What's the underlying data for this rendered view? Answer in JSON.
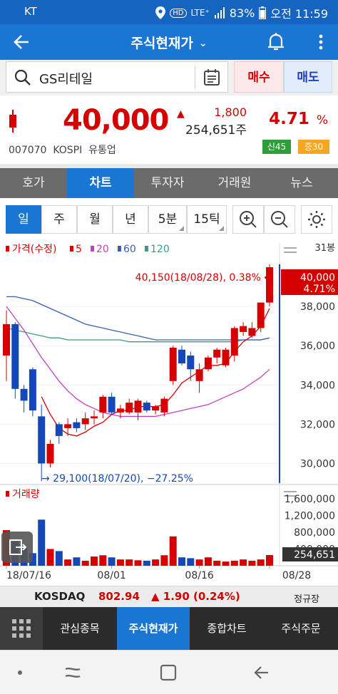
{
  "status_bar": {
    "carrier": "KT",
    "network": "LTE⁺",
    "battery": "83%",
    "time": "오전 11:59"
  },
  "app_bar": {
    "title": "주식현재가"
  },
  "search": {
    "value": "GS리테일",
    "buy_label": "매수",
    "sell_label": "매도"
  },
  "quote": {
    "price": "40,000",
    "change": "1,800",
    "volume": "254,651주",
    "percent": "4.71",
    "percent_unit": "%",
    "code_line": "007070  KOSPI  유통업",
    "badge_credit": "신45",
    "badge_margin": "증30"
  },
  "tabs": [
    "호가",
    "차트",
    "투자자",
    "거래원",
    "뉴스"
  ],
  "periods": [
    "일",
    "주",
    "월",
    "년",
    "5분",
    "15틱"
  ],
  "chart_data": {
    "type": "candlestick",
    "price_legend": {
      "label": "가격(수정)",
      "ma": [
        "5",
        "20",
        "60",
        "120"
      ]
    },
    "ma_colors": {
      "5": "#d50000",
      "20": "#c040c0",
      "60": "#3a5fb0",
      "120": "#3a9a8a"
    },
    "period_label": "31봉",
    "y_ticks": [
      "38,000",
      "36,000",
      "34,000",
      "32,000",
      "30,000"
    ],
    "ylim": [
      29000,
      41200
    ],
    "current_label": {
      "price": "40,000",
      "pct": "4.71%"
    },
    "high_annotation": "40,150(18/08/28), 0.38% ←",
    "low_annotation": "→ 29,100(18/07/20), −27.25%",
    "candles": [
      {
        "d": "07/16",
        "o": 35500,
        "h": 37800,
        "l": 34200,
        "c": 37100
      },
      {
        "d": "07/17",
        "o": 37100,
        "h": 37200,
        "l": 33300,
        "c": 33800
      },
      {
        "d": "07/18",
        "o": 33800,
        "h": 34000,
        "l": 32600,
        "c": 33200
      },
      {
        "d": "07/19",
        "o": 34800,
        "h": 34900,
        "l": 32400,
        "c": 32700
      },
      {
        "d": "07/20",
        "o": 32400,
        "h": 33000,
        "l": 29100,
        "c": 30000
      },
      {
        "d": "07/23",
        "o": 30000,
        "h": 31200,
        "l": 29800,
        "c": 31000
      },
      {
        "d": "07/24",
        "o": 32000,
        "h": 32100,
        "l": 31000,
        "c": 31400
      },
      {
        "d": "07/25",
        "o": 31800,
        "h": 32300,
        "l": 31400,
        "c": 32000
      },
      {
        "d": "07/26",
        "o": 32100,
        "h": 32300,
        "l": 31600,
        "c": 31800
      },
      {
        "d": "07/27",
        "o": 32000,
        "h": 32600,
        "l": 31700,
        "c": 32300
      },
      {
        "d": "07/30",
        "o": 32300,
        "h": 32700,
        "l": 32000,
        "c": 32400
      },
      {
        "d": "07/31",
        "o": 32600,
        "h": 33500,
        "l": 32300,
        "c": 33400
      },
      {
        "d": "08/01",
        "o": 33400,
        "h": 33600,
        "l": 32500,
        "c": 32600
      },
      {
        "d": "08/02",
        "o": 32600,
        "h": 33000,
        "l": 32300,
        "c": 32800
      },
      {
        "d": "08/03",
        "o": 32600,
        "h": 33300,
        "l": 32500,
        "c": 33100
      },
      {
        "d": "08/06",
        "o": 32600,
        "h": 33300,
        "l": 32200,
        "c": 33200
      },
      {
        "d": "08/07",
        "o": 33100,
        "h": 33200,
        "l": 32600,
        "c": 32700
      },
      {
        "d": "08/08",
        "o": 32700,
        "h": 33000,
        "l": 32500,
        "c": 32900
      },
      {
        "d": "08/09",
        "o": 32600,
        "h": 33400,
        "l": 32400,
        "c": 33300
      },
      {
        "d": "08/10",
        "o": 34200,
        "h": 36000,
        "l": 34000,
        "c": 35900
      },
      {
        "d": "08/13",
        "o": 35800,
        "h": 36000,
        "l": 35000,
        "c": 35100
      },
      {
        "d": "08/14",
        "o": 35500,
        "h": 35700,
        "l": 34200,
        "c": 34800
      },
      {
        "d": "08/16",
        "o": 34200,
        "h": 35100,
        "l": 33600,
        "c": 34800
      },
      {
        "d": "08/17",
        "o": 34800,
        "h": 35500,
        "l": 34700,
        "c": 35400
      },
      {
        "d": "08/20",
        "o": 35400,
        "h": 35900,
        "l": 35100,
        "c": 35800
      },
      {
        "d": "08/21",
        "o": 35000,
        "h": 35900,
        "l": 34900,
        "c": 35800
      },
      {
        "d": "08/22",
        "o": 35500,
        "h": 37000,
        "l": 35200,
        "c": 36900
      },
      {
        "d": "08/23",
        "o": 36700,
        "h": 37200,
        "l": 36500,
        "c": 37000
      },
      {
        "d": "08/24",
        "o": 36500,
        "h": 37200,
        "l": 36400,
        "c": 36900
      },
      {
        "d": "08/27",
        "o": 36900,
        "h": 38200,
        "l": 36700,
        "c": 38200
      },
      {
        "d": "08/28",
        "o": 38200,
        "h": 40150,
        "l": 38000,
        "c": 40000
      }
    ],
    "ma5": [
      null,
      null,
      null,
      null,
      33400,
      32500,
      31800,
      31500,
      31400,
      31600,
      31900,
      32100,
      32500,
      32700,
      32700,
      32900,
      32900,
      32900,
      33000,
      33500,
      34100,
      34400,
      34700,
      35000,
      35000,
      35100,
      35700,
      36200,
      36500,
      37000,
      37900
    ],
    "ma20": [
      38000,
      37400,
      36800,
      36100,
      35400,
      34800,
      34200,
      33700,
      33300,
      33000,
      32800,
      32600,
      32500,
      32400,
      32400,
      32400,
      32400,
      32400,
      32500,
      32600,
      32700,
      32800,
      32900,
      33000,
      33200,
      33400,
      33600,
      33800,
      34100,
      34400,
      34800
    ],
    "ma60": [
      38500,
      38500,
      38400,
      38300,
      38100,
      37900,
      37700,
      37500,
      37300,
      37100,
      37000,
      36900,
      36800,
      36700,
      36600,
      36500,
      36400,
      36300,
      36300,
      36300,
      36300,
      36300,
      36300,
      36300,
      36300,
      36300,
      36300,
      36300,
      36300,
      36300,
      36400
    ],
    "ma120": [
      36900,
      36800,
      36700,
      36600,
      36500,
      36400,
      36400,
      36300,
      36300,
      36300,
      36300,
      36300,
      36300,
      36300,
      36200,
      36200,
      36200,
      36200,
      36200,
      36200,
      36200,
      36200,
      36200,
      36200,
      36200,
      36200,
      36200,
      36300,
      36300,
      36300,
      36400
    ],
    "volume_legend": "거래량",
    "volume_ticks": [
      "1,600,000",
      "1,200,000",
      "800,000",
      "400,000"
    ],
    "volume_ylim": [
      0,
      1700000
    ],
    "current_volume": "254,651",
    "volumes": [
      850000,
      580000,
      450000,
      300000,
      1100000,
      400000,
      350000,
      150000,
      200000,
      120000,
      220000,
      250000,
      200000,
      150000,
      150000,
      130000,
      120000,
      150000,
      250000,
      700000,
      200000,
      180000,
      150000,
      200000,
      120000,
      100000,
      120000,
      150000,
      120000,
      150000,
      254651
    ],
    "x_ticks": [
      "18/07/16",
      "08/01",
      "08/16",
      "08/28"
    ]
  },
  "market": {
    "name": "KOSDAQ",
    "value": "802.94",
    "change": "▲ 1.90 (0.24%)",
    "session": "정규장"
  },
  "bottom_nav": [
    "관심종목",
    "주식현재가",
    "종합차트",
    "주식주문"
  ]
}
